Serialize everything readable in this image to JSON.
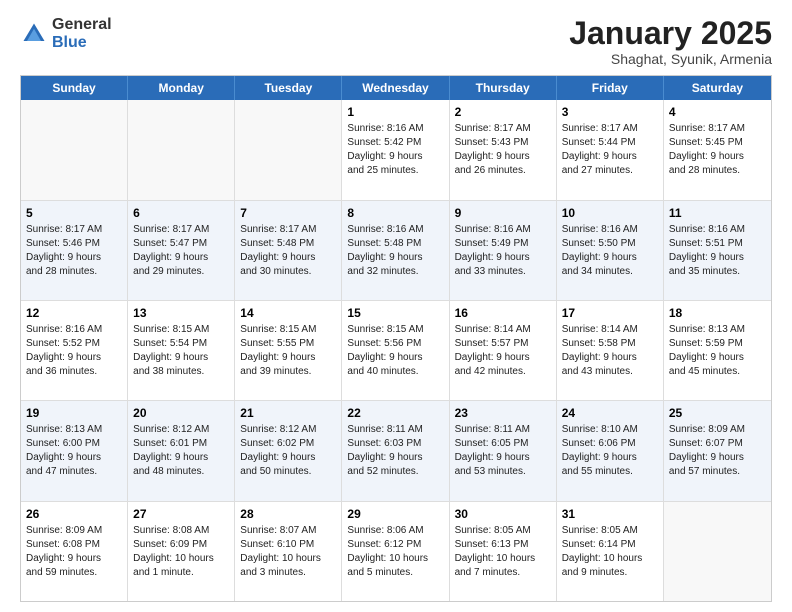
{
  "logo": {
    "general": "General",
    "blue": "Blue"
  },
  "title": "January 2025",
  "location": "Shaghat, Syunik, Armenia",
  "days": [
    "Sunday",
    "Monday",
    "Tuesday",
    "Wednesday",
    "Thursday",
    "Friday",
    "Saturday"
  ],
  "weeks": [
    [
      {
        "day": "",
        "info": ""
      },
      {
        "day": "",
        "info": ""
      },
      {
        "day": "",
        "info": ""
      },
      {
        "day": "1",
        "info": "Sunrise: 8:16 AM\nSunset: 5:42 PM\nDaylight: 9 hours\nand 25 minutes."
      },
      {
        "day": "2",
        "info": "Sunrise: 8:17 AM\nSunset: 5:43 PM\nDaylight: 9 hours\nand 26 minutes."
      },
      {
        "day": "3",
        "info": "Sunrise: 8:17 AM\nSunset: 5:44 PM\nDaylight: 9 hours\nand 27 minutes."
      },
      {
        "day": "4",
        "info": "Sunrise: 8:17 AM\nSunset: 5:45 PM\nDaylight: 9 hours\nand 28 minutes."
      }
    ],
    [
      {
        "day": "5",
        "info": "Sunrise: 8:17 AM\nSunset: 5:46 PM\nDaylight: 9 hours\nand 28 minutes."
      },
      {
        "day": "6",
        "info": "Sunrise: 8:17 AM\nSunset: 5:47 PM\nDaylight: 9 hours\nand 29 minutes."
      },
      {
        "day": "7",
        "info": "Sunrise: 8:17 AM\nSunset: 5:48 PM\nDaylight: 9 hours\nand 30 minutes."
      },
      {
        "day": "8",
        "info": "Sunrise: 8:16 AM\nSunset: 5:48 PM\nDaylight: 9 hours\nand 32 minutes."
      },
      {
        "day": "9",
        "info": "Sunrise: 8:16 AM\nSunset: 5:49 PM\nDaylight: 9 hours\nand 33 minutes."
      },
      {
        "day": "10",
        "info": "Sunrise: 8:16 AM\nSunset: 5:50 PM\nDaylight: 9 hours\nand 34 minutes."
      },
      {
        "day": "11",
        "info": "Sunrise: 8:16 AM\nSunset: 5:51 PM\nDaylight: 9 hours\nand 35 minutes."
      }
    ],
    [
      {
        "day": "12",
        "info": "Sunrise: 8:16 AM\nSunset: 5:52 PM\nDaylight: 9 hours\nand 36 minutes."
      },
      {
        "day": "13",
        "info": "Sunrise: 8:15 AM\nSunset: 5:54 PM\nDaylight: 9 hours\nand 38 minutes."
      },
      {
        "day": "14",
        "info": "Sunrise: 8:15 AM\nSunset: 5:55 PM\nDaylight: 9 hours\nand 39 minutes."
      },
      {
        "day": "15",
        "info": "Sunrise: 8:15 AM\nSunset: 5:56 PM\nDaylight: 9 hours\nand 40 minutes."
      },
      {
        "day": "16",
        "info": "Sunrise: 8:14 AM\nSunset: 5:57 PM\nDaylight: 9 hours\nand 42 minutes."
      },
      {
        "day": "17",
        "info": "Sunrise: 8:14 AM\nSunset: 5:58 PM\nDaylight: 9 hours\nand 43 minutes."
      },
      {
        "day": "18",
        "info": "Sunrise: 8:13 AM\nSunset: 5:59 PM\nDaylight: 9 hours\nand 45 minutes."
      }
    ],
    [
      {
        "day": "19",
        "info": "Sunrise: 8:13 AM\nSunset: 6:00 PM\nDaylight: 9 hours\nand 47 minutes."
      },
      {
        "day": "20",
        "info": "Sunrise: 8:12 AM\nSunset: 6:01 PM\nDaylight: 9 hours\nand 48 minutes."
      },
      {
        "day": "21",
        "info": "Sunrise: 8:12 AM\nSunset: 6:02 PM\nDaylight: 9 hours\nand 50 minutes."
      },
      {
        "day": "22",
        "info": "Sunrise: 8:11 AM\nSunset: 6:03 PM\nDaylight: 9 hours\nand 52 minutes."
      },
      {
        "day": "23",
        "info": "Sunrise: 8:11 AM\nSunset: 6:05 PM\nDaylight: 9 hours\nand 53 minutes."
      },
      {
        "day": "24",
        "info": "Sunrise: 8:10 AM\nSunset: 6:06 PM\nDaylight: 9 hours\nand 55 minutes."
      },
      {
        "day": "25",
        "info": "Sunrise: 8:09 AM\nSunset: 6:07 PM\nDaylight: 9 hours\nand 57 minutes."
      }
    ],
    [
      {
        "day": "26",
        "info": "Sunrise: 8:09 AM\nSunset: 6:08 PM\nDaylight: 9 hours\nand 59 minutes."
      },
      {
        "day": "27",
        "info": "Sunrise: 8:08 AM\nSunset: 6:09 PM\nDaylight: 10 hours\nand 1 minute."
      },
      {
        "day": "28",
        "info": "Sunrise: 8:07 AM\nSunset: 6:10 PM\nDaylight: 10 hours\nand 3 minutes."
      },
      {
        "day": "29",
        "info": "Sunrise: 8:06 AM\nSunset: 6:12 PM\nDaylight: 10 hours\nand 5 minutes."
      },
      {
        "day": "30",
        "info": "Sunrise: 8:05 AM\nSunset: 6:13 PM\nDaylight: 10 hours\nand 7 minutes."
      },
      {
        "day": "31",
        "info": "Sunrise: 8:05 AM\nSunset: 6:14 PM\nDaylight: 10 hours\nand 9 minutes."
      },
      {
        "day": "",
        "info": ""
      }
    ]
  ]
}
